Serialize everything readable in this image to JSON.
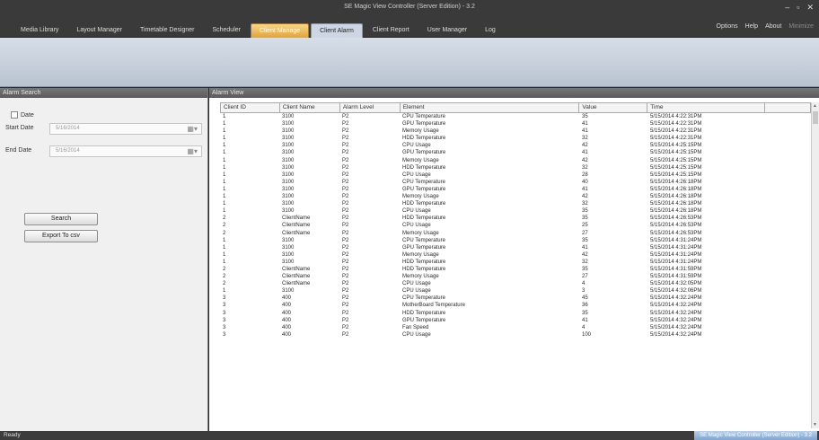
{
  "window": {
    "title": "SE Magic View Controller (Server Edition) - 3.2"
  },
  "menu": {
    "tabs": [
      "Media Library",
      "Layout Manager",
      "Timetable Designer",
      "Scheduler",
      "Client Manage",
      "Client Alarm",
      "Client Report",
      "User Manager",
      "Log"
    ],
    "right": [
      "Options",
      "Help",
      "About",
      "Minimize"
    ]
  },
  "alarm_search": {
    "title": "Alarm Search",
    "date_label": "Date",
    "start_label": "Start Date",
    "start_value": "5/16/2014",
    "end_label": "End Date",
    "end_value": "5/16/2014",
    "search_button": "Search",
    "export_button": "Export To csv"
  },
  "alarm_view": {
    "title": "Alarm View",
    "columns": [
      "Client ID",
      "Client Name",
      "Alarm Level",
      "Element",
      "Value",
      "Time"
    ],
    "rows": [
      [
        "1",
        "3100",
        "P2",
        "CPU Temperature",
        "35",
        "5/15/2014 4:22:31PM"
      ],
      [
        "1",
        "3100",
        "P2",
        "GPU Temperature",
        "41",
        "5/15/2014 4:22:31PM"
      ],
      [
        "1",
        "3100",
        "P2",
        "Memory Usage",
        "41",
        "5/15/2014 4:22:31PM"
      ],
      [
        "1",
        "3100",
        "P2",
        "HDD Temperature",
        "32",
        "5/15/2014 4:22:31PM"
      ],
      [
        "1",
        "3100",
        "P2",
        "CPU Usage",
        "42",
        "5/15/2014 4:25:15PM"
      ],
      [
        "1",
        "3100",
        "P2",
        "GPU Temperature",
        "41",
        "5/15/2014 4:25:15PM"
      ],
      [
        "1",
        "3100",
        "P2",
        "Memory Usage",
        "42",
        "5/15/2014 4:25:15PM"
      ],
      [
        "1",
        "3100",
        "P2",
        "HDD Temperature",
        "32",
        "5/15/2014 4:25:15PM"
      ],
      [
        "1",
        "3100",
        "P2",
        "CPU Usage",
        "28",
        "5/15/2014 4:25:15PM"
      ],
      [
        "1",
        "3100",
        "P2",
        "CPU Temperature",
        "40",
        "5/15/2014 4:26:18PM"
      ],
      [
        "1",
        "3100",
        "P2",
        "GPU Temperature",
        "41",
        "5/15/2014 4:26:18PM"
      ],
      [
        "1",
        "3100",
        "P2",
        "Memory Usage",
        "42",
        "5/15/2014 4:26:18PM"
      ],
      [
        "1",
        "3100",
        "P2",
        "HDD Temperature",
        "32",
        "5/15/2014 4:26:18PM"
      ],
      [
        "1",
        "3100",
        "P2",
        "CPU Usage",
        "35",
        "5/15/2014 4:26:18PM"
      ],
      [
        "2",
        "ClientName",
        "P2",
        "HDD Temperature",
        "35",
        "5/15/2014 4:26:53PM"
      ],
      [
        "2",
        "ClientName",
        "P2",
        "CPU Usage",
        "25",
        "5/15/2014 4:26:53PM"
      ],
      [
        "2",
        "ClientName",
        "P2",
        "Memory Usage",
        "27",
        "5/15/2014 4:26:53PM"
      ],
      [
        "1",
        "3100",
        "P2",
        "CPU Temperature",
        "35",
        "5/15/2014 4:31:24PM"
      ],
      [
        "1",
        "3100",
        "P2",
        "GPU Temperature",
        "41",
        "5/15/2014 4:31:24PM"
      ],
      [
        "1",
        "3100",
        "P2",
        "Memory Usage",
        "42",
        "5/15/2014 4:31:24PM"
      ],
      [
        "1",
        "3100",
        "P2",
        "HDD Temperature",
        "32",
        "5/15/2014 4:31:24PM"
      ],
      [
        "2",
        "ClientName",
        "P2",
        "HDD Temperature",
        "35",
        "5/15/2014 4:31:59PM"
      ],
      [
        "2",
        "ClientName",
        "P2",
        "Memory Usage",
        "27",
        "5/15/2014 4:31:59PM"
      ],
      [
        "2",
        "ClientName",
        "P2",
        "CPU Usage",
        "4",
        "5/15/2014 4:32:05PM"
      ],
      [
        "1",
        "3100",
        "P2",
        "CPU Usage",
        "3",
        "5/15/2014 4:32:06PM"
      ],
      [
        "3",
        "400",
        "P2",
        "CPU Temperature",
        "45",
        "5/15/2014 4:32:24PM"
      ],
      [
        "3",
        "400",
        "P2",
        "MotherBoard Temperature",
        "36",
        "5/15/2014 4:32:24PM"
      ],
      [
        "3",
        "400",
        "P2",
        "HDD Temperature",
        "35",
        "5/15/2014 4:32:24PM"
      ],
      [
        "3",
        "400",
        "P2",
        "GPU Temperature",
        "41",
        "5/15/2014 4:32:24PM"
      ],
      [
        "3",
        "400",
        "P2",
        "Fan Speed",
        "4",
        "5/15/2014 4:32:24PM"
      ],
      [
        "3",
        "400",
        "P2",
        "CPU Usage",
        "100",
        "5/15/2014 4:32:24PM"
      ]
    ]
  },
  "status": {
    "ready": "Ready",
    "edition": "SE Magic View Controller (Server Edition) - 3.2"
  },
  "colors": {
    "active_tab": "#e0a33a",
    "ribbon": "#c7d0dc"
  }
}
